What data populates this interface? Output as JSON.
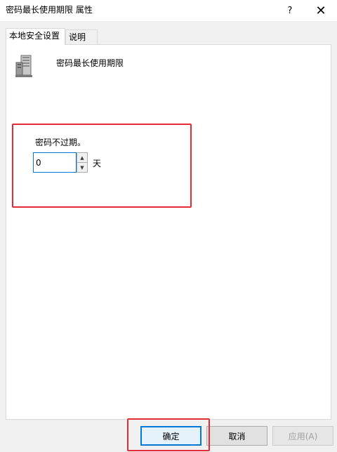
{
  "window": {
    "title": "密码最长使用期限 属性",
    "help_label": "?",
    "close_label": "✕"
  },
  "tabs": [
    {
      "label": "本地安全设置",
      "active": true
    },
    {
      "label": "说明",
      "active": false
    }
  ],
  "policy": {
    "name": "密码最长使用期限",
    "icon": "server-policy-icon",
    "expire_label": "密码不过期。",
    "value": "0",
    "unit": "天"
  },
  "buttons": {
    "ok": "确定",
    "cancel": "取消",
    "apply": "应用(A)"
  },
  "colors": {
    "highlight": "#e52a35",
    "focus": "#0078d7",
    "panel": "#ffffff",
    "window": "#f0f0f0"
  }
}
